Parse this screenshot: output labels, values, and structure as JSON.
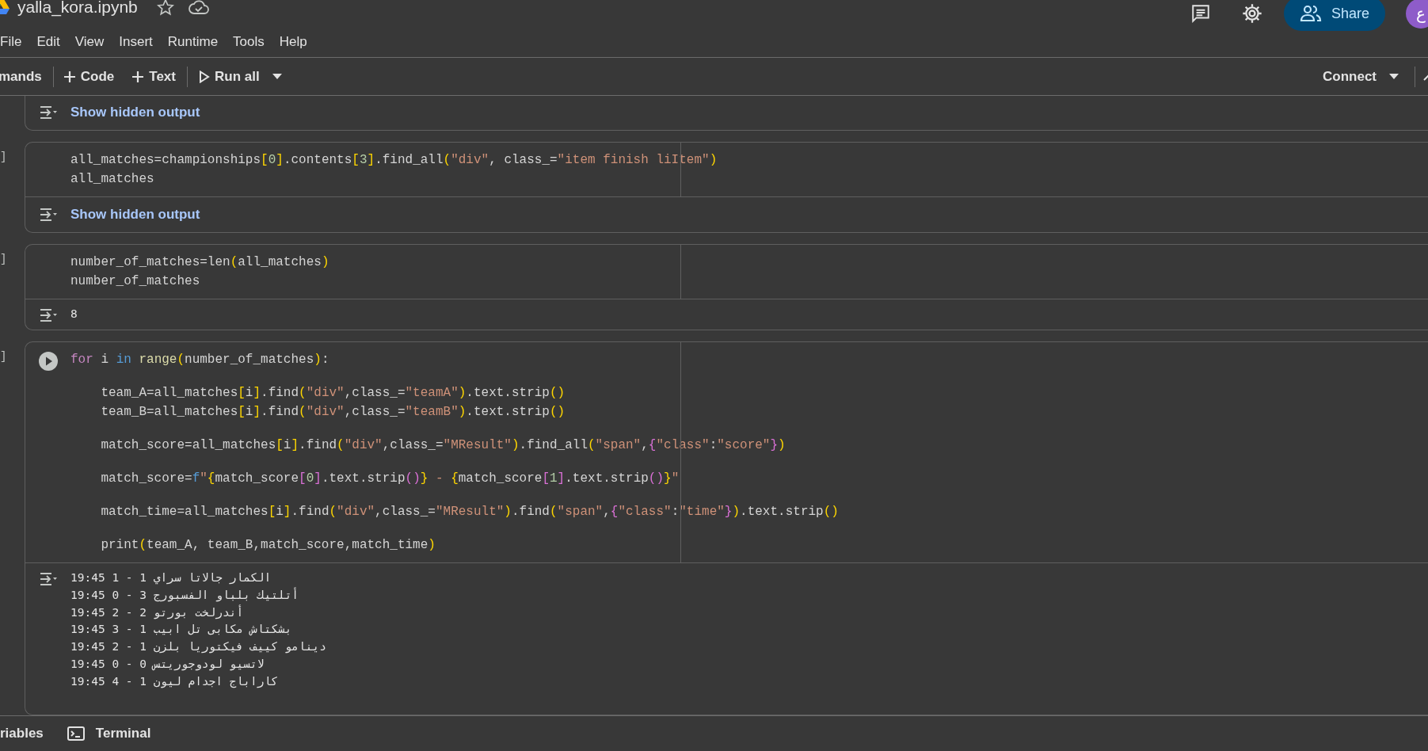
{
  "notebook": {
    "title": "yalla_kora.ipynb"
  },
  "menu": [
    "File",
    "Edit",
    "View",
    "Insert",
    "Runtime",
    "Tools",
    "Help"
  ],
  "header": {
    "share": "Share",
    "avatar": "ع"
  },
  "toolbar": {
    "commands": "mands",
    "add_code": "Code",
    "add_text": "Text",
    "run_all": "Run all",
    "connect": "Connect"
  },
  "cells": [
    {
      "kind": "output_only",
      "output": {
        "kind": "hidden",
        "text": "Show hidden output"
      }
    },
    {
      "kind": "code",
      "bracket": "]",
      "run_button": false,
      "code": [
        [
          [
            {
              "text": "all_matches=championships",
              "kind": "plain"
            },
            {
              "text": "[",
              "kind": "bracket"
            },
            {
              "text": "0",
              "kind": "number"
            },
            {
              "text": "]",
              "kind": "bracket"
            },
            {
              "text": ".contents",
              "kind": "plain"
            },
            {
              "text": "[",
              "kind": "bracket"
            },
            {
              "text": "3",
              "kind": "number"
            },
            {
              "text": "]",
              "kind": "bracket"
            },
            {
              "text": ".find_all",
              "kind": "plain"
            },
            {
              "text": "(",
              "kind": "bracket"
            },
            {
              "text": "\"div\"",
              "kind": "string"
            },
            {
              "text": ", class_=",
              "kind": "plain"
            },
            {
              "text": "\"item finish liItem\"",
              "kind": "string"
            },
            {
              "text": ")",
              "kind": "bracket"
            }
          ],
          [
            {
              "text": "all_matches",
              "kind": "plain"
            }
          ]
        ]
      ],
      "output": {
        "kind": "hidden",
        "text": "Show hidden output"
      }
    },
    {
      "kind": "code",
      "bracket": "]",
      "run_button": false,
      "code": [
        [
          [
            {
              "text": "number_of_matches=len",
              "kind": "plain"
            },
            {
              "text": "(",
              "kind": "bracket"
            },
            {
              "text": "all_matches",
              "kind": "plain"
            },
            {
              "text": ")",
              "kind": "bracket"
            }
          ],
          [
            {
              "text": "number_of_matches",
              "kind": "plain"
            }
          ]
        ]
      ],
      "output": {
        "kind": "text",
        "lines": [
          "8"
        ]
      }
    },
    {
      "kind": "code",
      "bracket": "]",
      "run_button": true,
      "code": [
        [
          [
            {
              "text": "for",
              "kind": "keyword"
            },
            {
              "text": " i ",
              "kind": "plain"
            },
            {
              "text": "in",
              "kind": "operator"
            },
            {
              "text": " range",
              "kind": "function"
            },
            {
              "text": "(",
              "kind": "bracket"
            },
            {
              "text": "number_of_matches",
              "kind": "plain"
            },
            {
              "text": ")",
              "kind": "bracket"
            },
            {
              "text": ":",
              "kind": "plain"
            }
          ]
        ],
        [
          [
            {
              "text": "    team_A=all_matches",
              "kind": "plain"
            },
            {
              "text": "[",
              "kind": "bracket"
            },
            {
              "text": "i",
              "kind": "plain"
            },
            {
              "text": "]",
              "kind": "bracket"
            },
            {
              "text": ".find",
              "kind": "plain"
            },
            {
              "text": "(",
              "kind": "bracket"
            },
            {
              "text": "\"div\"",
              "kind": "string"
            },
            {
              "text": ",class_=",
              "kind": "plain"
            },
            {
              "text": "\"teamA\"",
              "kind": "string"
            },
            {
              "text": ")",
              "kind": "bracket"
            },
            {
              "text": ".text.strip",
              "kind": "plain"
            },
            {
              "text": "()",
              "kind": "bracket"
            }
          ],
          [
            {
              "text": "    team_B=all_matches",
              "kind": "plain"
            },
            {
              "text": "[",
              "kind": "bracket"
            },
            {
              "text": "i",
              "kind": "plain"
            },
            {
              "text": "]",
              "kind": "bracket"
            },
            {
              "text": ".find",
              "kind": "plain"
            },
            {
              "text": "(",
              "kind": "bracket"
            },
            {
              "text": "\"div\"",
              "kind": "string"
            },
            {
              "text": ",class_=",
              "kind": "plain"
            },
            {
              "text": "\"teamB\"",
              "kind": "string"
            },
            {
              "text": ")",
              "kind": "bracket"
            },
            {
              "text": ".text.strip",
              "kind": "plain"
            },
            {
              "text": "()",
              "kind": "bracket"
            }
          ]
        ],
        [
          [
            {
              "text": "    match_score=all_matches",
              "kind": "plain"
            },
            {
              "text": "[",
              "kind": "bracket"
            },
            {
              "text": "i",
              "kind": "plain"
            },
            {
              "text": "]",
              "kind": "bracket"
            },
            {
              "text": ".find",
              "kind": "plain"
            },
            {
              "text": "(",
              "kind": "bracket"
            },
            {
              "text": "\"div\"",
              "kind": "string"
            },
            {
              "text": ",class_=",
              "kind": "plain"
            },
            {
              "text": "\"MResult\"",
              "kind": "string"
            },
            {
              "text": ")",
              "kind": "bracket"
            },
            {
              "text": ".find_all",
              "kind": "plain"
            },
            {
              "text": "(",
              "kind": "bracket"
            },
            {
              "text": "\"span\"",
              "kind": "string"
            },
            {
              "text": ",",
              "kind": "plain"
            },
            {
              "text": "{",
              "kind": "bracket2"
            },
            {
              "text": "\"class\"",
              "kind": "string"
            },
            {
              "text": ":",
              "kind": "plain"
            },
            {
              "text": "\"score\"",
              "kind": "string"
            },
            {
              "text": "}",
              "kind": "bracket2"
            },
            {
              "text": ")",
              "kind": "bracket"
            }
          ]
        ],
        [
          [
            {
              "text": "    match_score=",
              "kind": "plain"
            },
            {
              "text": "f",
              "kind": "operator"
            },
            {
              "text": "\"",
              "kind": "string"
            },
            {
              "text": "{",
              "kind": "bracket"
            },
            {
              "text": "match_score",
              "kind": "plain"
            },
            {
              "text": "[",
              "kind": "bracket2"
            },
            {
              "text": "0",
              "kind": "number"
            },
            {
              "text": "]",
              "kind": "bracket2"
            },
            {
              "text": ".text.strip",
              "kind": "plain"
            },
            {
              "text": "()",
              "kind": "bracket2"
            },
            {
              "text": "}",
              "kind": "bracket"
            },
            {
              "text": " - ",
              "kind": "string"
            },
            {
              "text": "{",
              "kind": "bracket"
            },
            {
              "text": "match_score",
              "kind": "plain"
            },
            {
              "text": "[",
              "kind": "bracket2"
            },
            {
              "text": "1",
              "kind": "number"
            },
            {
              "text": "]",
              "kind": "bracket2"
            },
            {
              "text": ".text.strip",
              "kind": "plain"
            },
            {
              "text": "()",
              "kind": "bracket2"
            },
            {
              "text": "}",
              "kind": "bracket"
            },
            {
              "text": "\"",
              "kind": "string"
            }
          ]
        ],
        [
          [
            {
              "text": "    match_time=all_matches",
              "kind": "plain"
            },
            {
              "text": "[",
              "kind": "bracket"
            },
            {
              "text": "i",
              "kind": "plain"
            },
            {
              "text": "]",
              "kind": "bracket"
            },
            {
              "text": ".find",
              "kind": "plain"
            },
            {
              "text": "(",
              "kind": "bracket"
            },
            {
              "text": "\"div\"",
              "kind": "string"
            },
            {
              "text": ",class_=",
              "kind": "plain"
            },
            {
              "text": "\"MResult\"",
              "kind": "string"
            },
            {
              "text": ")",
              "kind": "bracket"
            },
            {
              "text": ".find",
              "kind": "plain"
            },
            {
              "text": "(",
              "kind": "bracket"
            },
            {
              "text": "\"span\"",
              "kind": "string"
            },
            {
              "text": ",",
              "kind": "plain"
            },
            {
              "text": "{",
              "kind": "bracket2"
            },
            {
              "text": "\"class\"",
              "kind": "string"
            },
            {
              "text": ":",
              "kind": "plain"
            },
            {
              "text": "\"time\"",
              "kind": "string"
            },
            {
              "text": "}",
              "kind": "bracket2"
            },
            {
              "text": ")",
              "kind": "bracket"
            },
            {
              "text": ".text.strip",
              "kind": "plain"
            },
            {
              "text": "()",
              "kind": "bracket"
            }
          ]
        ],
        [
          [
            {
              "text": "    print",
              "kind": "plain"
            },
            {
              "text": "(",
              "kind": "bracket"
            },
            {
              "text": "team_A, team_B,match_score,match_time",
              "kind": "plain"
            },
            {
              "text": ")",
              "kind": "bracket"
            }
          ]
        ]
      ],
      "output": {
        "kind": "text",
        "lines": [
          "19:45 1 - 1 الكمار جالاتا سراي",
          "19:45 0 - 3 أتلتيك بلباو الفسبورج",
          "19:45 2 - 2 أندرلخت بورتو",
          "19:45 3 - 1 بشكتاش مكابى تل ابيب",
          "19:45 2 - 1 دينامو كييف فيكتوريا بلزن",
          "19:45 0 - 0 لاتسيو لودوجوريتس",
          "19:45 4 - 1 كاراباج اجدام ليون"
        ]
      }
    }
  ],
  "bottom_bar": {
    "variables": "riables",
    "terminal": "Terminal"
  }
}
